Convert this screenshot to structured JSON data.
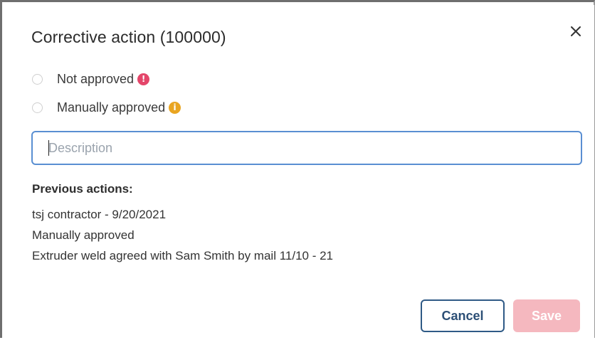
{
  "dialog": {
    "title": "Corrective action (100000)",
    "close_icon": "close-icon"
  },
  "options": [
    {
      "label": "Not approved",
      "selected": false,
      "badge_icon": "error-icon",
      "badge_color": "#e4466a",
      "badge_glyph": "!"
    },
    {
      "label": "Manually approved",
      "selected": false,
      "badge_icon": "info-icon",
      "badge_color": "#e9a521",
      "badge_glyph": "i"
    }
  ],
  "description": {
    "value": "",
    "placeholder": "Description"
  },
  "previous": {
    "label": "Previous actions:",
    "lines": [
      "tsj contractor - 9/20/2021",
      "Manually approved",
      "Extruder weld agreed with Sam Smith by mail 11/10 - 21"
    ]
  },
  "buttons": {
    "cancel_label": "Cancel",
    "save_label": "Save"
  },
  "colors": {
    "input_border": "#5a8fd2",
    "cancel_border": "#2f5a86",
    "save_disabled": "#f5b8bf"
  }
}
